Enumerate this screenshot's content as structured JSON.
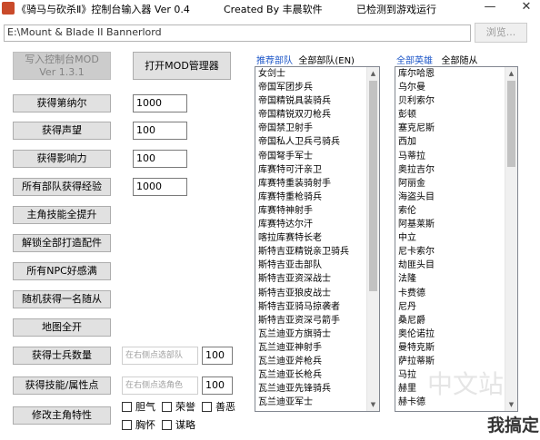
{
  "window": {
    "title": "《骑马与砍杀Ⅱ》控制台输入器 Ver 0.4",
    "created": "Created  By 丰晨软件",
    "status": "已检测到游戏运行",
    "minimize": "—",
    "close": "✕"
  },
  "path": {
    "value": "E:\\Mount & Blade II Bannerlord",
    "browse_label": "浏览..."
  },
  "top_buttons": {
    "write_line1": "写入控制台MOD",
    "write_line2": "Ver 1.3.1",
    "mod_manager": "打开MOD管理器"
  },
  "actions": {
    "get_dinar": "获得第纳尔",
    "dinar_value": "1000",
    "get_renown": "获得声望",
    "renown_value": "100",
    "get_influence": "获得影响力",
    "influence_value": "100",
    "all_troops_xp": "所有部队获得经验",
    "xp_value": "1000",
    "skills_up": "主角技能全提升",
    "unlock_parts": "解锁全部打造配件",
    "npc_relation": "所有NPC好感满",
    "random_follower": "随机获得一名随从",
    "map_open": "地图全开",
    "get_soldiers": "获得士兵数量",
    "soldier_placeholder": "在右侧点选部队",
    "soldier_value": "100",
    "get_skill_attr": "获得技能/属性点",
    "skill_placeholder": "在右侧点选角色",
    "skill_value": "100",
    "modify_traits": "修改主角特性"
  },
  "traits": [
    "胆气",
    "荣誉",
    "善恶",
    "胸怀",
    "谋略"
  ],
  "troops_panel": {
    "header_recommend": "推荐部队",
    "header_all": "全部部队(EN)",
    "items": [
      "女剑士",
      "帝国军团步兵",
      "帝国精锐具装骑兵",
      "帝国精锐双刃枪兵",
      "帝国禁卫射手",
      "帝国私人卫兵弓骑兵",
      "帝国弩手军士",
      "库赛特可汗亲卫",
      "库赛特重装骑射手",
      "库赛特重枪骑兵",
      "库赛特神射手",
      "库赛特达尔汗",
      "喀拉库赛特长老",
      "斯特吉亚精锐亲卫骑兵",
      "斯特吉亚击部队",
      "斯特吉亚资深战士",
      "斯特吉亚狼皮战士",
      "斯特吉亚骑马掠袭者",
      "斯特吉亚资深弓箭手",
      "瓦兰迪亚方旗骑士",
      "瓦兰迪亚神射手",
      "瓦兰迪亚斧枪兵",
      "瓦兰迪亚长枪兵",
      "瓦兰迪亚先锋骑兵",
      "瓦兰迪亚军士"
    ]
  },
  "heroes_panel": {
    "header_all_heroes": "全部英雄",
    "header_all_followers": "全部随从",
    "items": [
      "库尔哈恩",
      "乌尔曼",
      "贝利索尔",
      "彭顿",
      "塞克尼斯",
      "西加",
      "马蒂拉",
      "奥拉吉尔",
      "阿丽金",
      "海盗头目",
      "索伦",
      "阿基莱斯",
      "中立",
      "尼卡索尔",
      "劫匪头目",
      "法隆",
      "卡费德",
      "尼丹",
      "桑尼爵",
      "奥伦诺拉",
      "曼特克斯",
      "萨拉蒂斯",
      "马拉",
      "赫里",
      "赫卡德"
    ]
  },
  "watermark": {
    "text": "我搞定",
    "faint": "中文站"
  },
  "colors": {
    "accent_blue": "#1e57c8",
    "button_bg": "#e1e1e1",
    "disabled_bg": "#cccccc"
  }
}
